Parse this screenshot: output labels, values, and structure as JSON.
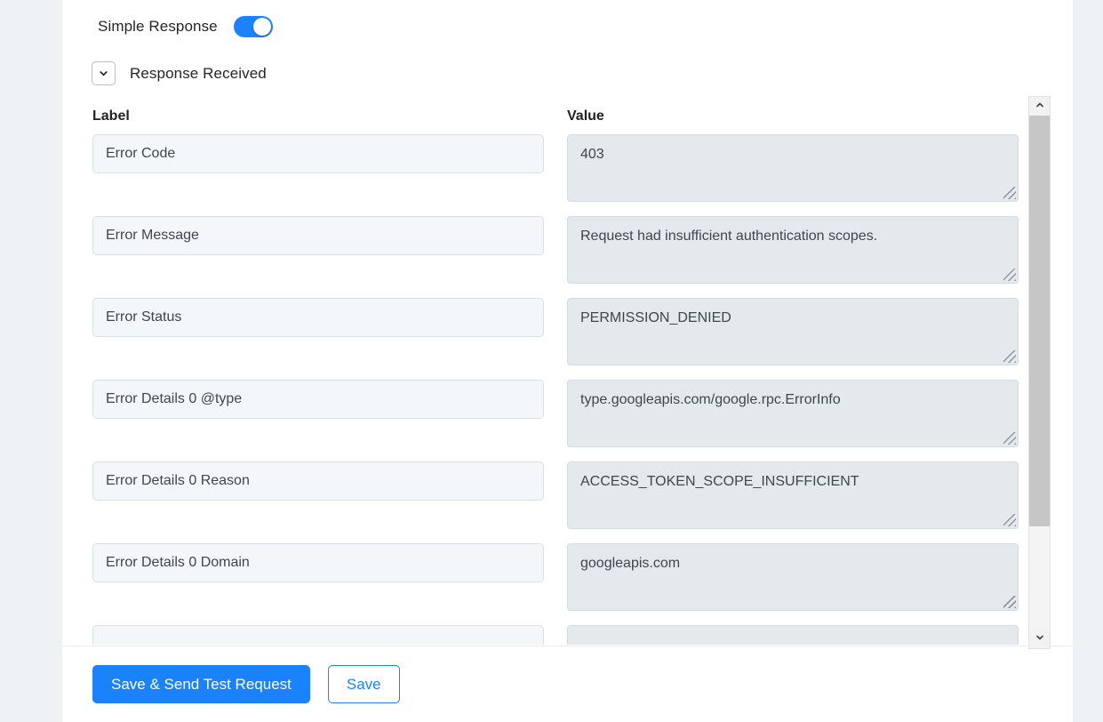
{
  "colors": {
    "accent": "#1a82fb",
    "card_bg": "#ffffff",
    "page_bg": "#eef2f5",
    "label_input_bg": "#f3f7f9",
    "value_area_bg": "#e4e9ed",
    "scrollbar_thumb": "#c6c6c6"
  },
  "toggle": {
    "label": "Simple Response",
    "state": "on"
  },
  "section": {
    "label": "Response Received",
    "expanded": true,
    "chevron_icon": "chevron-down-icon"
  },
  "columns": {
    "label_header": "Label",
    "value_header": "Value"
  },
  "rows": [
    {
      "label": "Error Code",
      "value": "403"
    },
    {
      "label": "Error Message",
      "value": "Request had insufficient authentication scopes."
    },
    {
      "label": "Error Status",
      "value": "PERMISSION_DENIED"
    },
    {
      "label": "Error Details 0 @type",
      "value": "type.googleapis.com/google.rpc.ErrorInfo"
    },
    {
      "label": "Error Details 0 Reason",
      "value": "ACCESS_TOKEN_SCOPE_INSUFFICIENT"
    },
    {
      "label": "Error Details 0 Domain",
      "value": "googleapis.com"
    },
    {
      "label": "",
      "value": ""
    }
  ],
  "scrollbar": {
    "up_icon": "chevron-up-icon",
    "down_icon": "chevron-down-icon",
    "orientation": "vertical"
  },
  "footer": {
    "primary_label": "Save & Send Test Request",
    "secondary_label": "Save"
  }
}
